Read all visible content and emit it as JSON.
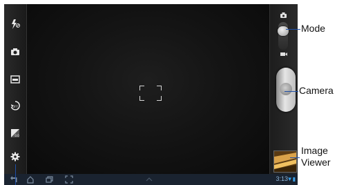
{
  "left_bar": {
    "buttons": [
      {
        "name": "flash-off-icon",
        "label": "⚡"
      },
      {
        "name": "shooting-mode-icon",
        "label": ""
      },
      {
        "name": "scene-mode-icon",
        "label": ""
      },
      {
        "name": "focus-mode-icon",
        "label": ""
      },
      {
        "name": "exposure-value-icon",
        "label": ""
      },
      {
        "name": "settings-icon",
        "label": ""
      }
    ]
  },
  "callouts": {
    "mode": "Mode",
    "camera": "Camera",
    "image_viewer_line1": "Image",
    "image_viewer_line2": "Viewer"
  },
  "status_bar": {
    "time": "3:13",
    "icons": [
      "wifi-icon",
      "battery-icon"
    ]
  },
  "colors": {
    "callout_line": "#1e4fa8",
    "system_bar": "#1a2330",
    "status_blue": "#3aa0e8"
  }
}
